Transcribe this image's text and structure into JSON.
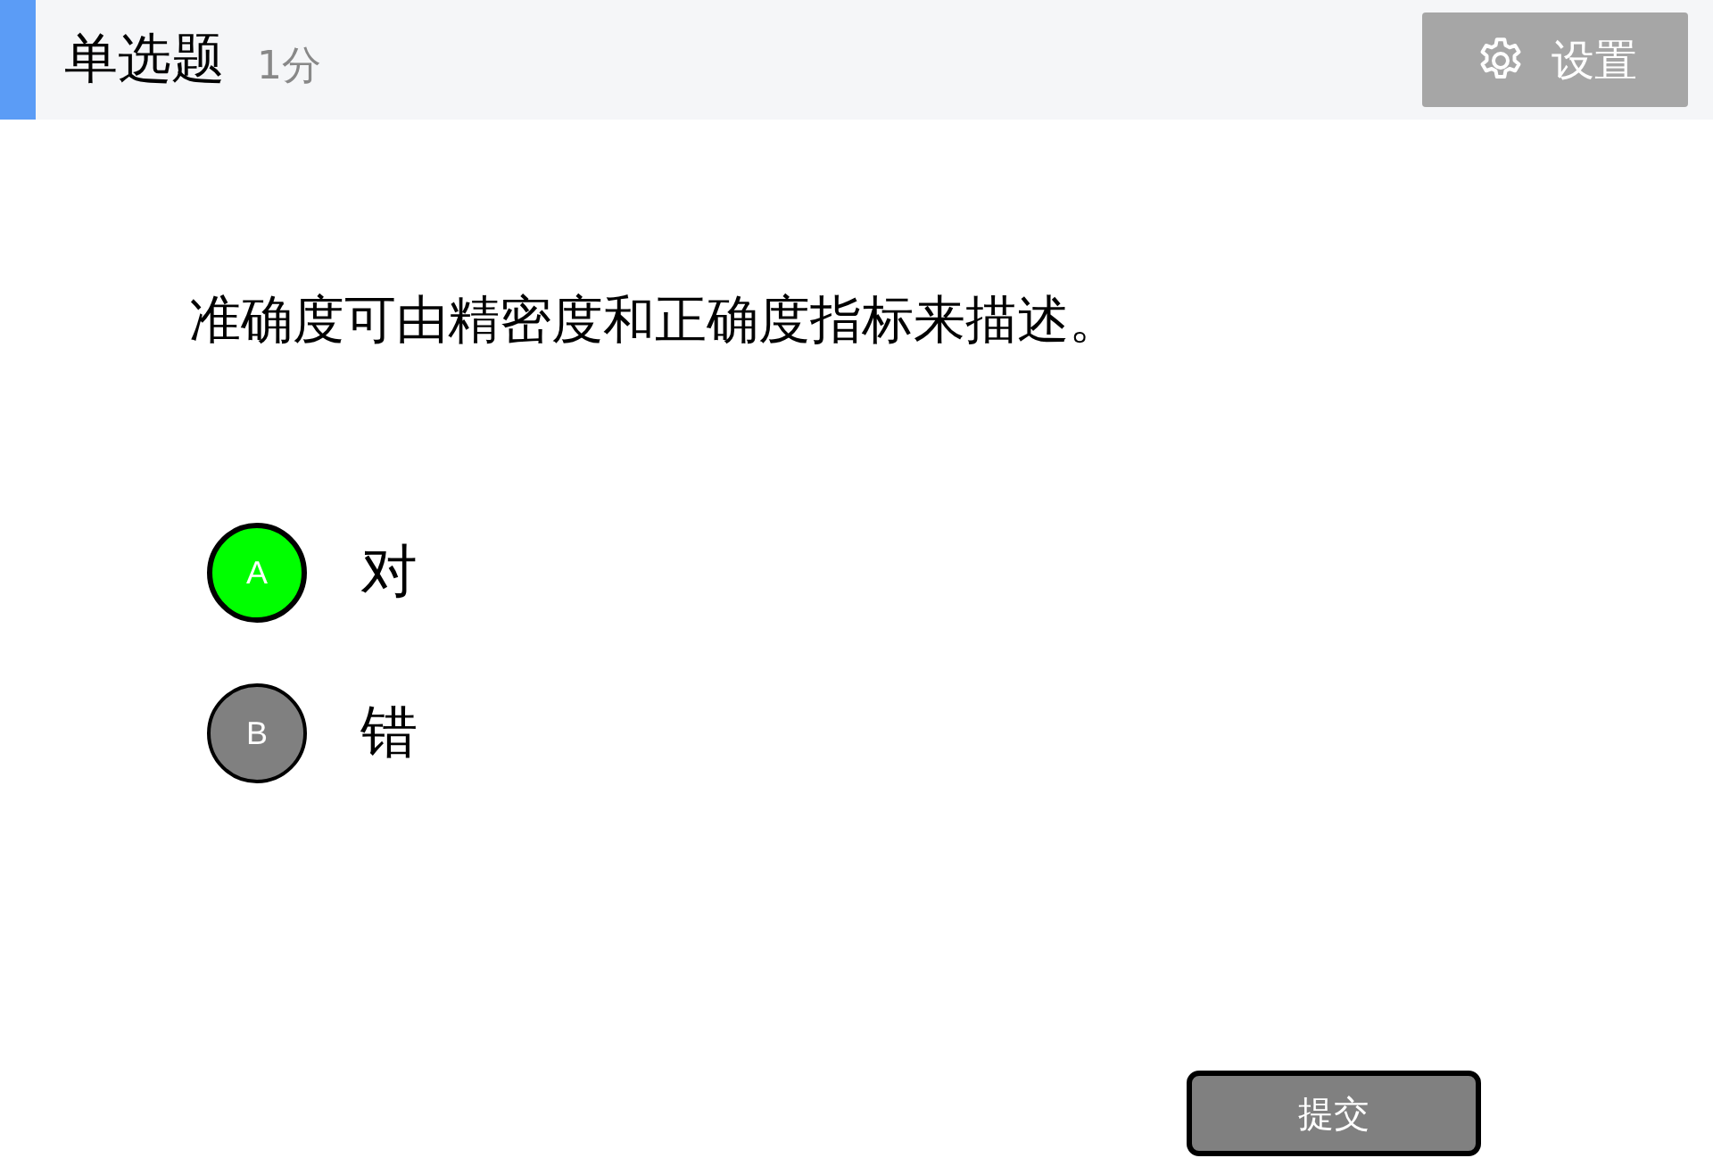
{
  "header": {
    "title": "单选题",
    "score": "1分",
    "settings_button": "设置"
  },
  "question": "准确度可由精密度和正确度指标来描述。",
  "options": [
    {
      "letter": "A",
      "text": "对",
      "selected": true
    },
    {
      "letter": "B",
      "text": "错",
      "selected": false
    }
  ],
  "submit_button": "提交"
}
